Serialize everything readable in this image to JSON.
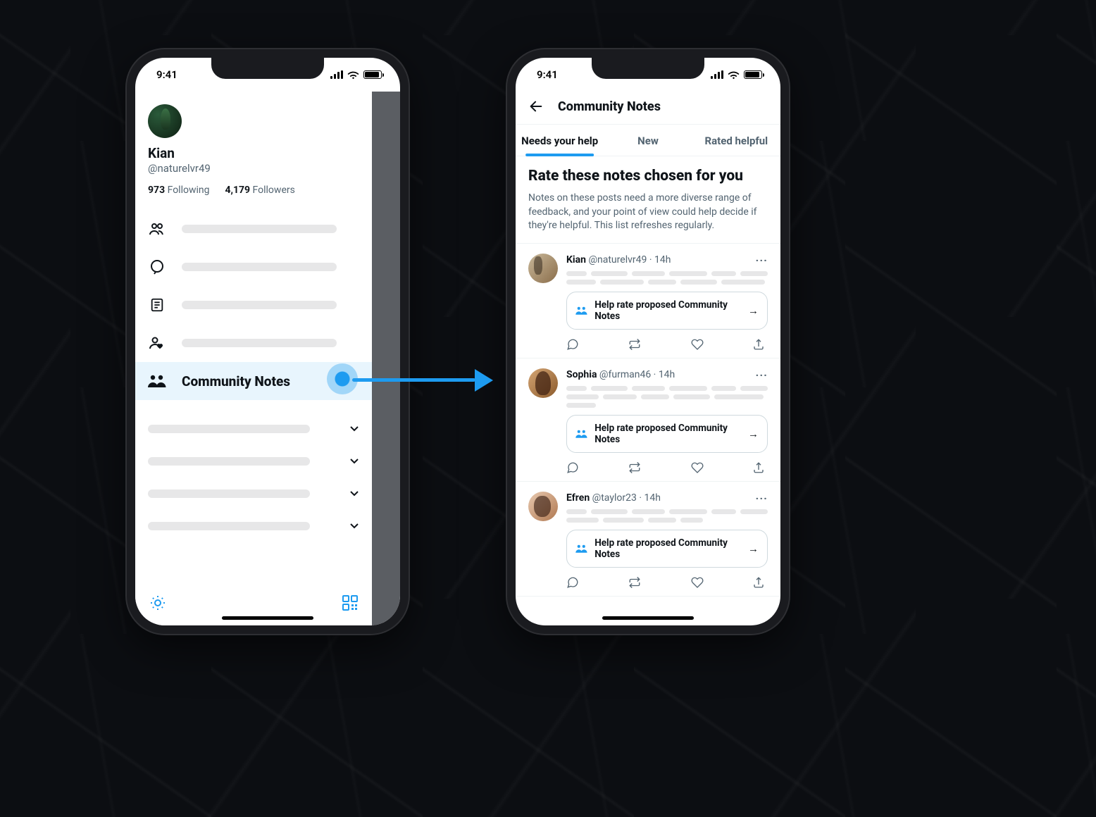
{
  "statusbar": {
    "time": "9:41"
  },
  "left": {
    "profile": {
      "name": "Kian",
      "handle": "@naturelvr49"
    },
    "stats": {
      "following_count": "973",
      "following_label": "Following",
      "followers_count": "4,179",
      "followers_label": "Followers"
    },
    "menu": {
      "community_notes": "Community Notes"
    }
  },
  "right": {
    "header_title": "Community Notes",
    "tabs": {
      "needs_help": "Needs your help",
      "new": "New",
      "rated_helpful": "Rated helpful"
    },
    "rate": {
      "title": "Rate these notes chosen for you",
      "desc": "Notes on these posts need a more diverse range of feedback, and your point of view could help decide if they're helpful. This list refreshes regularly."
    },
    "card_label": "Help rate proposed Community Notes",
    "posts": [
      {
        "name": "Kian",
        "handle": "@naturelvr49",
        "time": "14h"
      },
      {
        "name": "Sophia",
        "handle": "@furman46",
        "time": "14h"
      },
      {
        "name": "Efren",
        "handle": "@taylor23",
        "time": "14h"
      }
    ]
  }
}
